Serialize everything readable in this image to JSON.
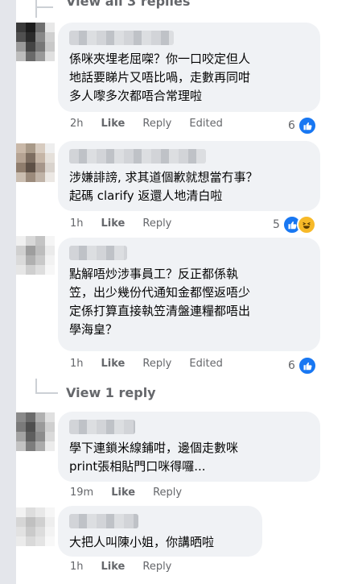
{
  "top_link": "View all 3 replies",
  "comments": [
    {
      "text_lines": [
        "係咪夾埋老屈㗎？你一口咬定但人",
        "地話要睇片又唔比喎，走數再同咁",
        "多人嚟多次都唔合常理啦"
      ],
      "time": "2h",
      "like": "Like",
      "reply": "Reply",
      "edited": "Edited",
      "reactions_count": "6",
      "reaction_icons": [
        "like-icon"
      ]
    },
    {
      "text_lines": [
        "涉嫌誹謗, 求其道個歉就想當冇事？",
        "起碼 clarify 返還人地清白啦"
      ],
      "time": "1h",
      "like": "Like",
      "reply": "Reply",
      "reactions_count": "5",
      "reaction_icons": [
        "like-icon",
        "haha-icon"
      ]
    },
    {
      "text_lines": [
        "點解唔炒涉事員工？反正都係執",
        "笠，出少幾份代通知金都慳返唔少",
        "定係打算直接執笠清盤連糧都唔出",
        "學海皇？"
      ],
      "time": "1h",
      "like": "Like",
      "reply": "Reply",
      "edited": "Edited",
      "reactions_count": "6",
      "reaction_icons": [
        "like-icon"
      ]
    },
    {
      "text_lines": [
        "學下連鎖米線鋪咁，邊個走數咪",
        "print張相貼門口咪得囉..."
      ],
      "time": "19m",
      "like": "Like",
      "reply": "Reply"
    },
    {
      "text_lines": [
        "大把人叫陳小姐，你講晒啦"
      ],
      "time": "1h",
      "like": "Like",
      "reply": "Reply"
    }
  ],
  "view_replies": "View 1 reply",
  "colors": {
    "bubble": "#f0f2f5",
    "meta": "#65676b",
    "like_blue": "#1877f2",
    "haha_yellow": "#f7b928"
  }
}
